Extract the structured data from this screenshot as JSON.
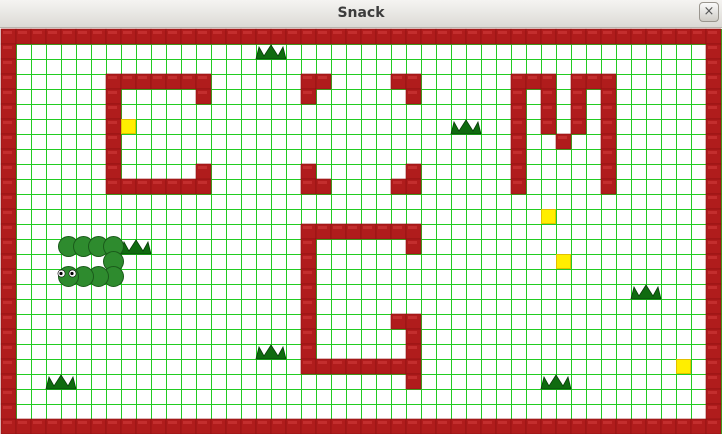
{
  "window": {
    "title": "Snack",
    "close_glyph": "×"
  },
  "board": {
    "grid_color": "#22cc22",
    "background": "#ffffff",
    "wall_color": "#b01c1c",
    "food_color": "#ffee00",
    "snake_color": "#2e8b2e",
    "grass_color": "#0f6b0f"
  }
}
